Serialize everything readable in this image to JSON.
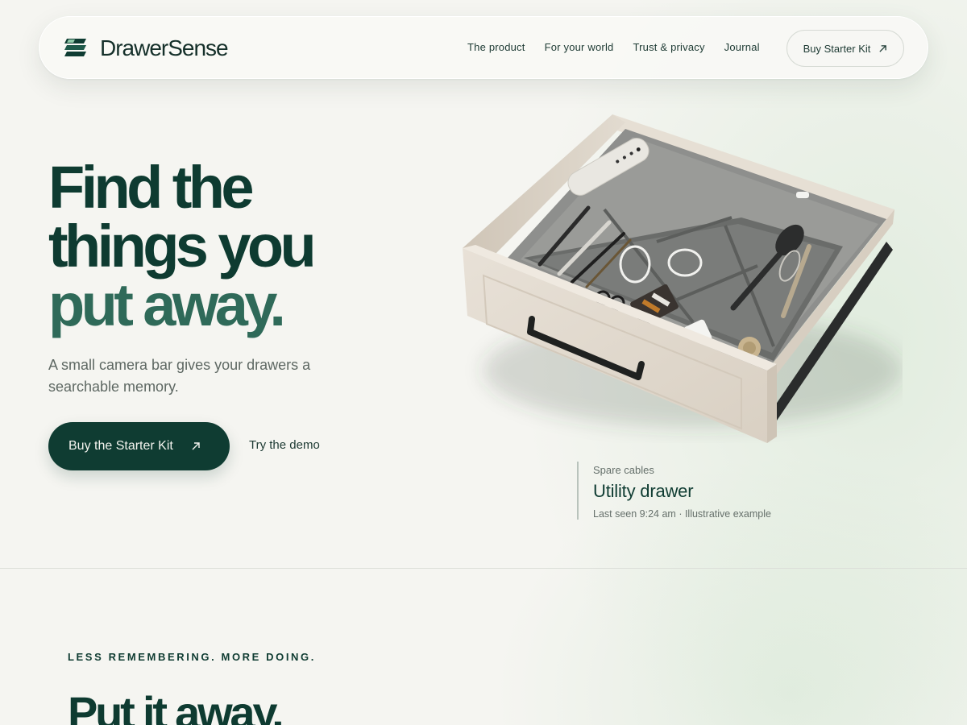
{
  "brand": {
    "name": "DrawerSense",
    "logo_icon": "stacked-layers-icon"
  },
  "nav": {
    "links": [
      "The product",
      "For your world",
      "Trust & privacy",
      "Journal"
    ],
    "cta_label": "Buy Starter Kit",
    "cta_icon": "arrow-up-right-icon"
  },
  "hero": {
    "headline_lines": [
      "Find the",
      "things you",
      "put away."
    ],
    "subcopy": "A small camera bar gives your drawers a searchable memory.",
    "primary_cta": "Buy the Starter Kit",
    "secondary_cta": "Try the demo",
    "image_subject": "open-drawer-organizer-image"
  },
  "caption": {
    "item": "Spare cables",
    "location": "Utility drawer",
    "meta": "Last seen 9:24 am · Illustrative example"
  },
  "section2": {
    "eyebrow": "LESS REMEMBERING. MORE DOING.",
    "title": "Put it away."
  },
  "colors": {
    "brand_dark": "#0f3c32",
    "accent_green": "#2f6a59",
    "background": "#f5f5f1"
  }
}
